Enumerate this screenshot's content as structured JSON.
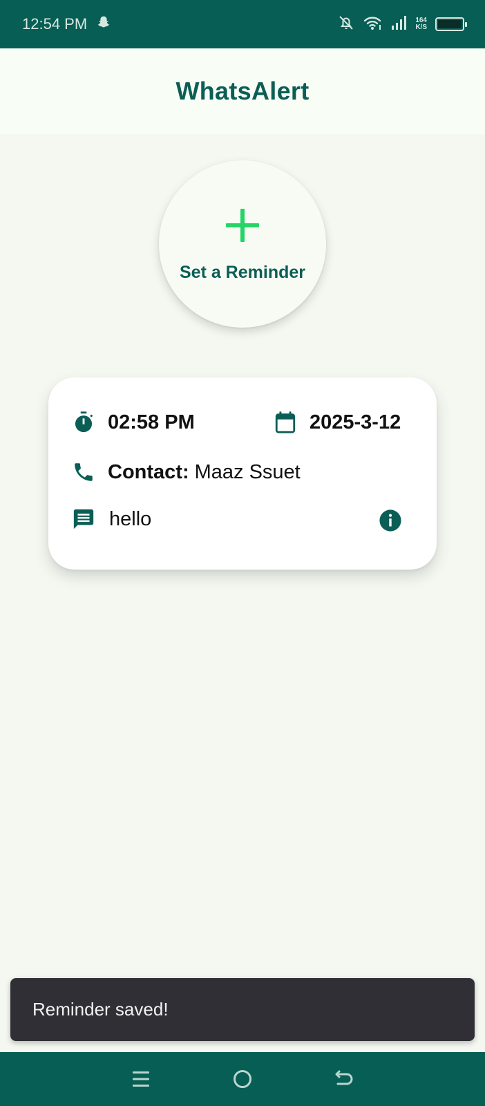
{
  "status_bar": {
    "time": "12:54 PM",
    "net_speed_value": "164",
    "net_speed_unit": "K/S"
  },
  "header": {
    "title": "WhatsAlert"
  },
  "fab": {
    "label": "Set a Reminder"
  },
  "reminder": {
    "time": "02:58 PM",
    "date": "2025-3-12",
    "contact_label": "Contact:",
    "contact_name": "Maaz Ssuet",
    "message": "hello"
  },
  "snackbar": {
    "text": "Reminder saved!"
  },
  "colors": {
    "primary": "#075e54",
    "accent": "#25d366",
    "background": "#f4f8f1",
    "card": "#ffffff",
    "snackbar": "#302f35"
  },
  "icons": {
    "time": "timer-icon",
    "date": "calendar-icon",
    "contact": "phone-icon",
    "message": "message-icon",
    "info": "info-icon",
    "add": "plus-icon"
  }
}
